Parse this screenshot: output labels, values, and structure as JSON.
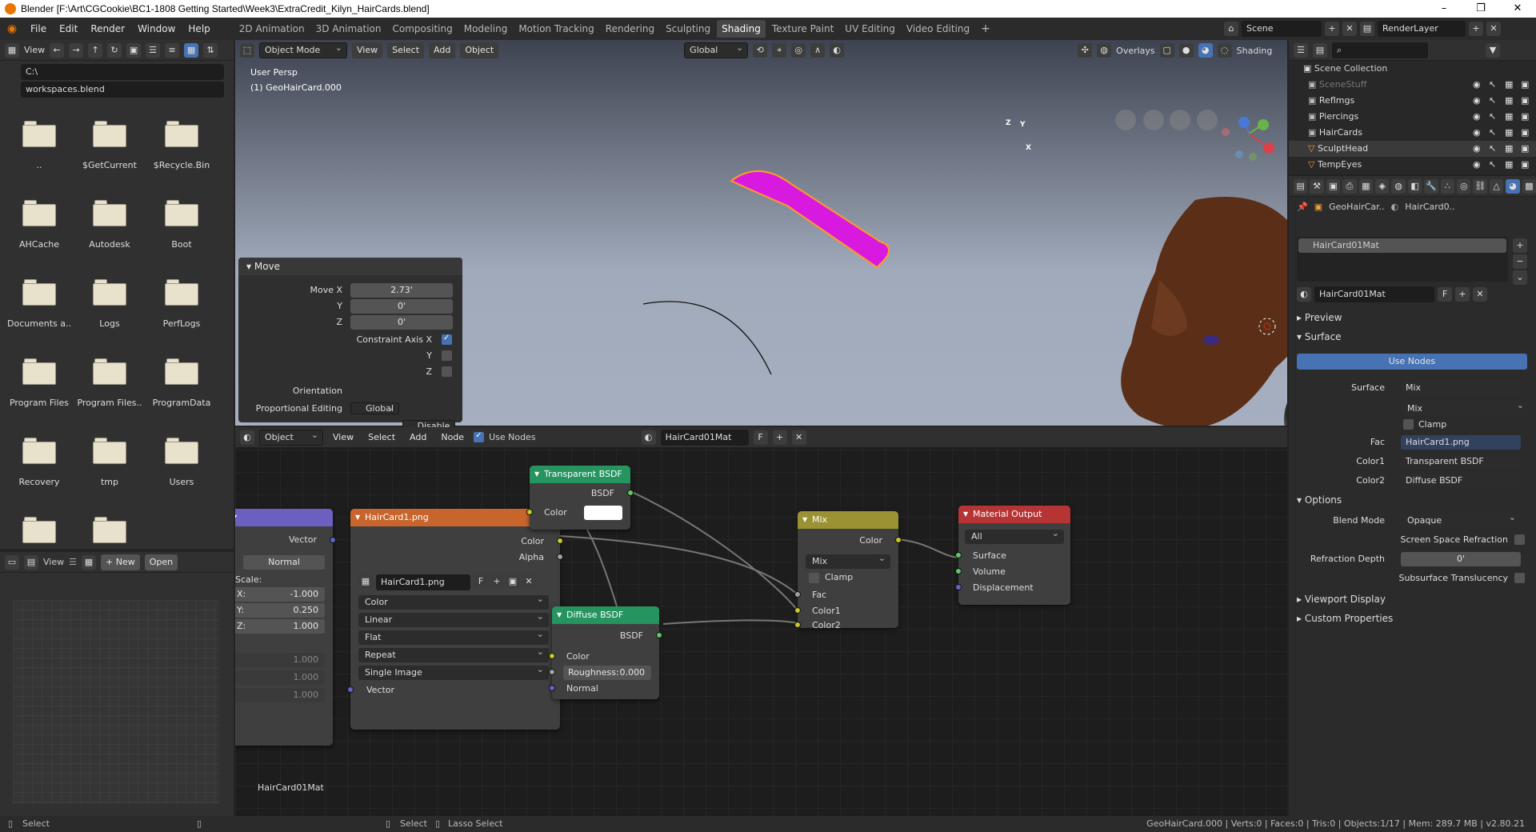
{
  "window": {
    "title": "Blender [F:\\Art\\CGCookie\\BC1-1808 Getting Started\\Week3\\ExtraCredit_Kilyn_HairCards.blend]"
  },
  "menu": [
    "File",
    "Edit",
    "Render",
    "Window",
    "Help"
  ],
  "workspaces": [
    "2D Animation",
    "3D Animation",
    "Compositing",
    "Modeling",
    "Motion Tracking",
    "Rendering",
    "Sculpting",
    "Shading",
    "Texture Paint",
    "UV Editing",
    "Video Editing"
  ],
  "active_workspace": "Shading",
  "scene": {
    "name": "Scene",
    "render_layer": "RenderLayer"
  },
  "file_browser": {
    "view_label": "View",
    "path": "C:\\",
    "filename": "workspaces.blend",
    "items": [
      "..",
      "$GetCurrent",
      "$Recycle.Bin",
      "AHCache",
      "Autodesk",
      "Boot",
      "Documents a..",
      "Logs",
      "PerfLogs",
      "Program Files",
      "Program Files..",
      "ProgramData",
      "Recovery",
      "tmp",
      "Users",
      "",
      ""
    ]
  },
  "image_editor": {
    "view": "View",
    "new": "New",
    "open": "Open"
  },
  "viewport": {
    "mode": "Object Mode",
    "menus": [
      "View",
      "Select",
      "Add",
      "Object"
    ],
    "orientation": "Global",
    "overlays": "Overlays",
    "shading": "Shading",
    "info_line1": "User Persp",
    "info_line2": "(1) GeoHairCard.000",
    "axis": {
      "z": "Z",
      "y": "Y",
      "x": "X"
    }
  },
  "move_panel": {
    "title": "Move",
    "move_x_label": "Move X",
    "move_x": "2.73'",
    "y_label": "Y",
    "y": "0'",
    "z_label": "Z",
    "z": "0'",
    "constraint_label": "Constraint Axis X",
    "cy": "Y",
    "cz": "Z",
    "orientation_label": "Orientation",
    "orientation": "Global",
    "prop_edit_label": "Proportional Editing",
    "prop_edit": "Disable"
  },
  "node_editor": {
    "type": "Object",
    "menus": [
      "View",
      "Select",
      "Add",
      "Node"
    ],
    "use_nodes": "Use Nodes",
    "material": "HairCard01Mat",
    "footer": "HairCard01Mat",
    "mapping": {
      "vector": "Vector",
      "normal": "Normal",
      "scale": "Scale:",
      "x": "X:",
      "xv": "-1.000",
      "y": "Y:",
      "yv": "0.250",
      "z": "Z:",
      "zv": "1.000",
      "g1": "1.000",
      "g2": "1.000",
      "g3": "1.000"
    },
    "image_node": {
      "title": "HairCard1.png",
      "out_color": "Color",
      "out_alpha": "Alpha",
      "image": "HairCard1.png",
      "f": "F",
      "d1": "Color",
      "d2": "Linear",
      "d3": "Flat",
      "d4": "Repeat",
      "d5": "Single Image",
      "in_vector": "Vector"
    },
    "transparent": {
      "title": "Transparent BSDF",
      "out": "BSDF",
      "color": "Color"
    },
    "diffuse": {
      "title": "Diffuse BSDF",
      "out": "BSDF",
      "color": "Color",
      "rough_label": "Roughness:",
      "rough": "0.000",
      "normal": "Normal"
    },
    "mix": {
      "title": "Mix",
      "out": "Color",
      "blend": "Mix",
      "clamp": "Clamp",
      "fac": "Fac",
      "c1": "Color1",
      "c2": "Color2"
    },
    "output": {
      "title": "Material Output",
      "target": "All",
      "surface": "Surface",
      "volume": "Volume",
      "displacement": "Displacement"
    }
  },
  "outliner": {
    "root": "Scene Collection",
    "items": [
      "SceneStuff",
      "Reflmgs",
      "Piercings",
      "HairCards",
      "SculptHead",
      "TempEyes"
    ]
  },
  "properties": {
    "object": "GeoHairCar..",
    "material_tab": "HairCard0..",
    "slot": "HairCard01Mat",
    "material": "HairCard01Mat",
    "f": "F",
    "preview": "Preview",
    "surface_section": "Surface",
    "use_nodes": "Use Nodes",
    "surface_label": "Surface",
    "surface": "Mix",
    "blend_type": "Mix",
    "clamp": "Clamp",
    "fac_label": "Fac",
    "fac": "HairCard1.png",
    "color1_label": "Color1",
    "color1": "Transparent BSDF",
    "color2_label": "Color2",
    "color2": "Diffuse BSDF",
    "options": "Options",
    "blend_mode_label": "Blend Mode",
    "blend_mode": "Opaque",
    "ssr_label": "Screen Space Refraction",
    "refr_depth_label": "Refraction Depth",
    "refr_depth": "0'",
    "sss_label": "Subsurface Translucency",
    "viewport_display": "Viewport Display",
    "custom_props": "Custom Properties"
  },
  "status": {
    "left": "Select",
    "mid1": "Select",
    "mid2": "Lasso Select",
    "right": "GeoHairCard.000 | Verts:0 | Faces:0 | Tris:0 | Objects:1/17 | Mem: 289.7 MB | v2.80.21"
  }
}
